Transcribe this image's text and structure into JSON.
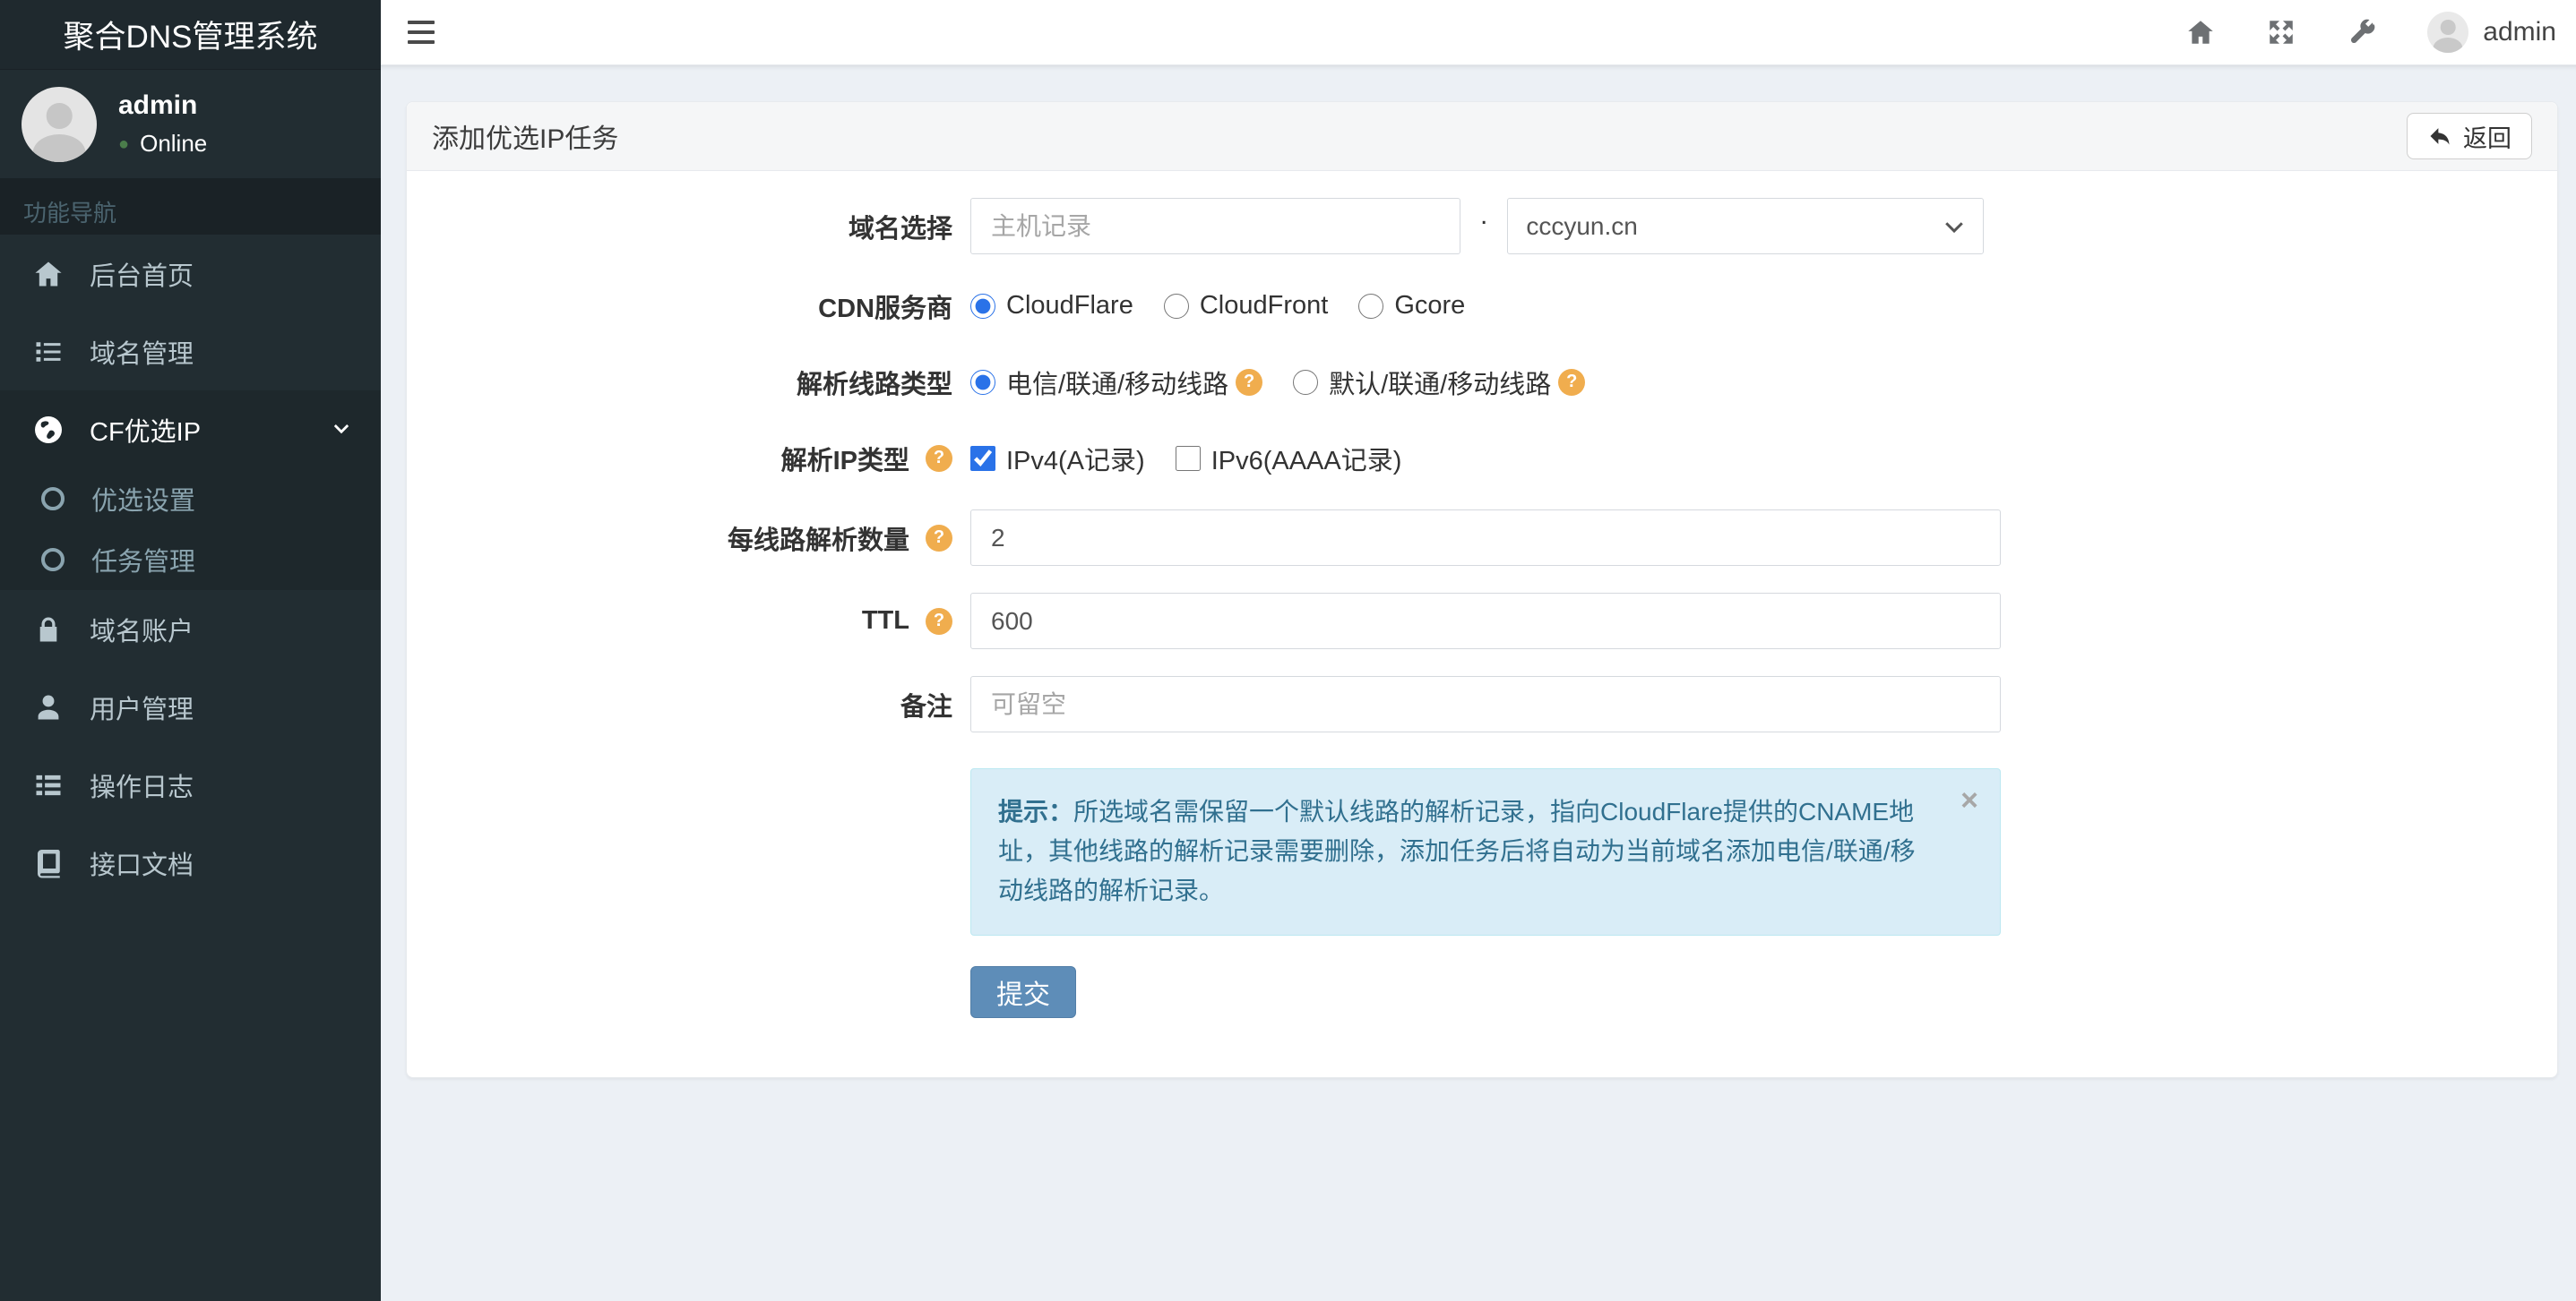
{
  "app": {
    "title": "聚合DNS管理系统"
  },
  "navbar": {
    "username": "admin"
  },
  "sidebar": {
    "user": {
      "name": "admin",
      "status": "Online"
    },
    "section_header": "功能导航",
    "items": [
      {
        "label": "后台首页",
        "icon": "home"
      },
      {
        "label": "域名管理",
        "icon": "list"
      },
      {
        "label": "CF优选IP",
        "icon": "globe",
        "active": true,
        "expanded": true,
        "children": [
          {
            "label": "优选设置"
          },
          {
            "label": "任务管理"
          }
        ]
      },
      {
        "label": "域名账户",
        "icon": "lock"
      },
      {
        "label": "用户管理",
        "icon": "user"
      },
      {
        "label": "操作日志",
        "icon": "th-list"
      },
      {
        "label": "接口文档",
        "icon": "book"
      }
    ]
  },
  "panel": {
    "title": "添加优选IP任务",
    "back_button": "返回",
    "form": {
      "domain": {
        "label": "域名选择",
        "host_placeholder": "主机记录",
        "separator": ".",
        "selected_domain": "cccyun.cn"
      },
      "cdn": {
        "label": "CDN服务商",
        "options": [
          {
            "label": "CloudFlare",
            "selected": true
          },
          {
            "label": "CloudFront",
            "selected": false
          },
          {
            "label": "Gcore",
            "selected": false
          }
        ]
      },
      "line_type": {
        "label": "解析线路类型",
        "options": [
          {
            "label": "电信/联通/移动线路",
            "selected": true,
            "has_help": true
          },
          {
            "label": "默认/联通/移动线路",
            "selected": false,
            "has_help": true
          }
        ]
      },
      "ip_type": {
        "label": "解析IP类型",
        "has_help": true,
        "options": [
          {
            "label": "IPv4(A记录)",
            "checked": true
          },
          {
            "label": "IPv6(AAAA记录)",
            "checked": false
          }
        ]
      },
      "per_line_count": {
        "label": "每线路解析数量",
        "has_help": true,
        "value": "2"
      },
      "ttl": {
        "label": "TTL",
        "has_help": true,
        "value": "600"
      },
      "remark": {
        "label": "备注",
        "placeholder": "可留空"
      }
    },
    "alert": {
      "prefix": "提示：",
      "text": "所选域名需保留一个默认线路的解析记录，指向CloudFlare提供的CNAME地址，其他线路的解析记录需要删除，添加任务后将自动为当前域名添加电信/联通/移动线路的解析记录。",
      "close_glyph": "×"
    },
    "submit_button": "提交"
  },
  "icons": {
    "help_glyph": "?",
    "online_dot": "●"
  },
  "colors": {
    "sidebar_bg": "#222d32",
    "sidebar_active_bg": "#1e282c",
    "content_bg": "#ecf0f5",
    "accent_blue": "#2a72e8",
    "submit_bg": "#5e8db8",
    "alert_bg": "#d9edf7",
    "alert_border": "#bce8f1",
    "alert_text": "#31708f",
    "help_bg": "#f0ad4e",
    "online_green": "#4b7d4b"
  }
}
